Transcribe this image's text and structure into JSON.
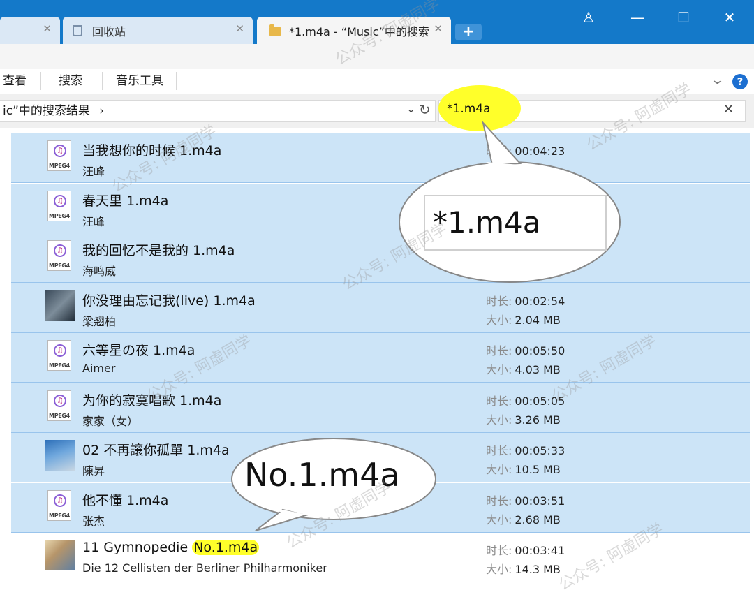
{
  "titlebar": {
    "tabs": [
      {
        "label": "",
        "active": false
      },
      {
        "label": "回收站",
        "active": false
      },
      {
        "label": "*1.m4a - “Music”中的搜索",
        "active": true
      }
    ],
    "new_tab": "+",
    "controls": {
      "profile": "♙",
      "minimize": "—",
      "maximize": "☐",
      "close": "✕"
    }
  },
  "ribbon": {
    "tabs": [
      "查看",
      "搜索",
      "音乐工具"
    ],
    "help": "?"
  },
  "address": {
    "path": "ic”中的搜索结果",
    "sep": "›"
  },
  "search": {
    "value": "*1.m4a",
    "clear": "✕"
  },
  "files": [
    {
      "name": "当我想你的时候 1.m4a",
      "artist": "汪峰",
      "duration_label": "时长:",
      "duration": "00:04:23",
      "size_label": "",
      "size": "",
      "icon": "mpeg4-icon",
      "selected": true
    },
    {
      "name": "春天里 1.m4a",
      "artist": "汪峰",
      "duration_label": "",
      "duration": "",
      "size_label": "",
      "size": "",
      "icon": "mpeg4-icon",
      "selected": true
    },
    {
      "name": "我的回忆不是我的 1.m4a",
      "artist": "海鸣威",
      "duration_label": "",
      "duration": "",
      "size_label": "",
      "size": "",
      "icon": "mpeg4-icon",
      "selected": true
    },
    {
      "name": "你没理由忘记我(live) 1.m4a",
      "artist": "梁翘柏",
      "duration_label": "时长:",
      "duration": "00:02:54",
      "size_label": "大小:",
      "size": "2.04 MB",
      "icon": "album-photo",
      "selected": true
    },
    {
      "name": "六等星の夜 1.m4a",
      "artist": "Aimer",
      "duration_label": "时长:",
      "duration": "00:05:50",
      "size_label": "大小:",
      "size": "4.03 MB",
      "icon": "mpeg4-icon",
      "selected": true
    },
    {
      "name": "为你的寂寞唱歌 1.m4a",
      "artist": "家家（女）",
      "duration_label": "时长:",
      "duration": "00:05:05",
      "size_label": "大小:",
      "size": "3.26 MB",
      "icon": "mpeg4-icon",
      "selected": true
    },
    {
      "name": "02 不再讓你孤單 1.m4a",
      "artist": "陳昇",
      "duration_label": "时长:",
      "duration": "00:05:33",
      "size_label": "大小:",
      "size": "10.5 MB",
      "icon": "album-photo",
      "selected": true
    },
    {
      "name": "他不懂 1.m4a",
      "artist": "张杰",
      "duration_label": "时长:",
      "duration": "00:03:51",
      "size_label": "大小:",
      "size": "2.68 MB",
      "icon": "mpeg4-icon",
      "selected": true
    },
    {
      "name_prefix": "11 Gymnopedie ",
      "name_highlight": "No.1.m4a",
      "artist": "Die 12 Cellisten der Berliner Philharmoniker",
      "duration_label": "时长:",
      "duration": "00:03:41",
      "size_label": "大小:",
      "size": "14.3 MB",
      "icon": "album-photo",
      "selected": false
    }
  ],
  "mpeg_icon_label": "MPEG4",
  "callouts": {
    "top": "*1.m4a",
    "bottom": "No.1.m4a"
  },
  "watermark": "公众号: 阿虚同学",
  "colors": {
    "titlebar": "#1479c9",
    "selection": "#cce4f7",
    "highlight": "#ffff2a",
    "help": "#1c6fd1"
  }
}
